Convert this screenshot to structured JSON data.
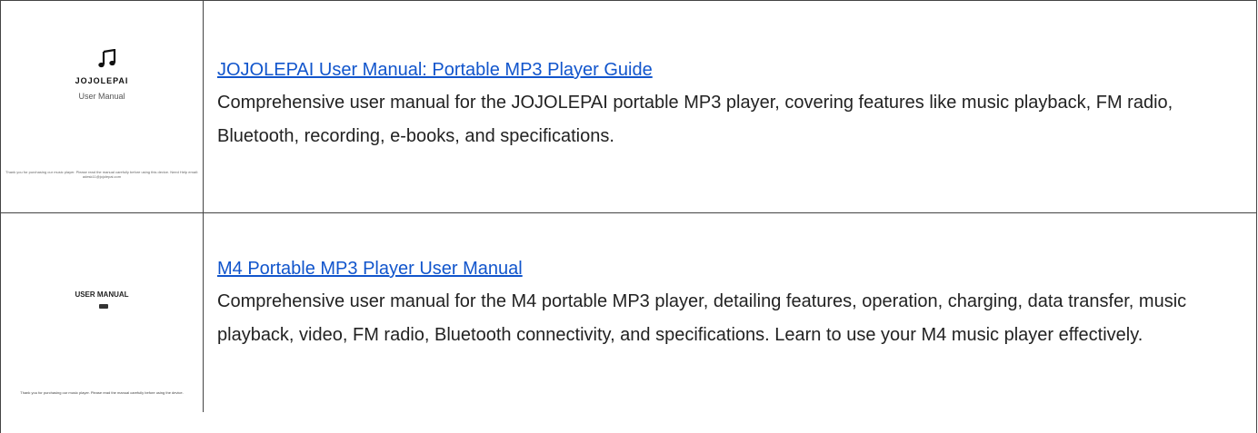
{
  "results": [
    {
      "title": "JOJOLEPAI User Manual: Portable MP3 Player Guide",
      "description": "Comprehensive user manual for the JOJOLEPAI portable MP3 player, covering features like music playback, FM radio, Bluetooth, recording, e-books, and specifications.",
      "thumbnail": {
        "brand": "JOJOLEPAI",
        "subtitle": "User Manual",
        "fine_print": "Thank you for purchasing our music player. Please read the manual carefully before using this device. Need Help email: adesk11@jojolepai.com",
        "icon": "music-note-icon"
      }
    },
    {
      "title": "M4 Portable MP3 Player User Manual",
      "description": "Comprehensive user manual for the M4 portable MP3 player, detailing features, operation, charging, data transfer, music playback, video, FM radio, Bluetooth connectivity, and specifications. Learn to use your M4 music player effectively.",
      "thumbnail": {
        "subtitle": "USER MANUAL",
        "fine_print": "Thank you for purchasing our music player. Please read the manual carefully before using the device.",
        "icon": "mp3-player-icon"
      }
    }
  ],
  "colors": {
    "link": "#1155cc",
    "text": "#222222",
    "border": "#444444"
  }
}
